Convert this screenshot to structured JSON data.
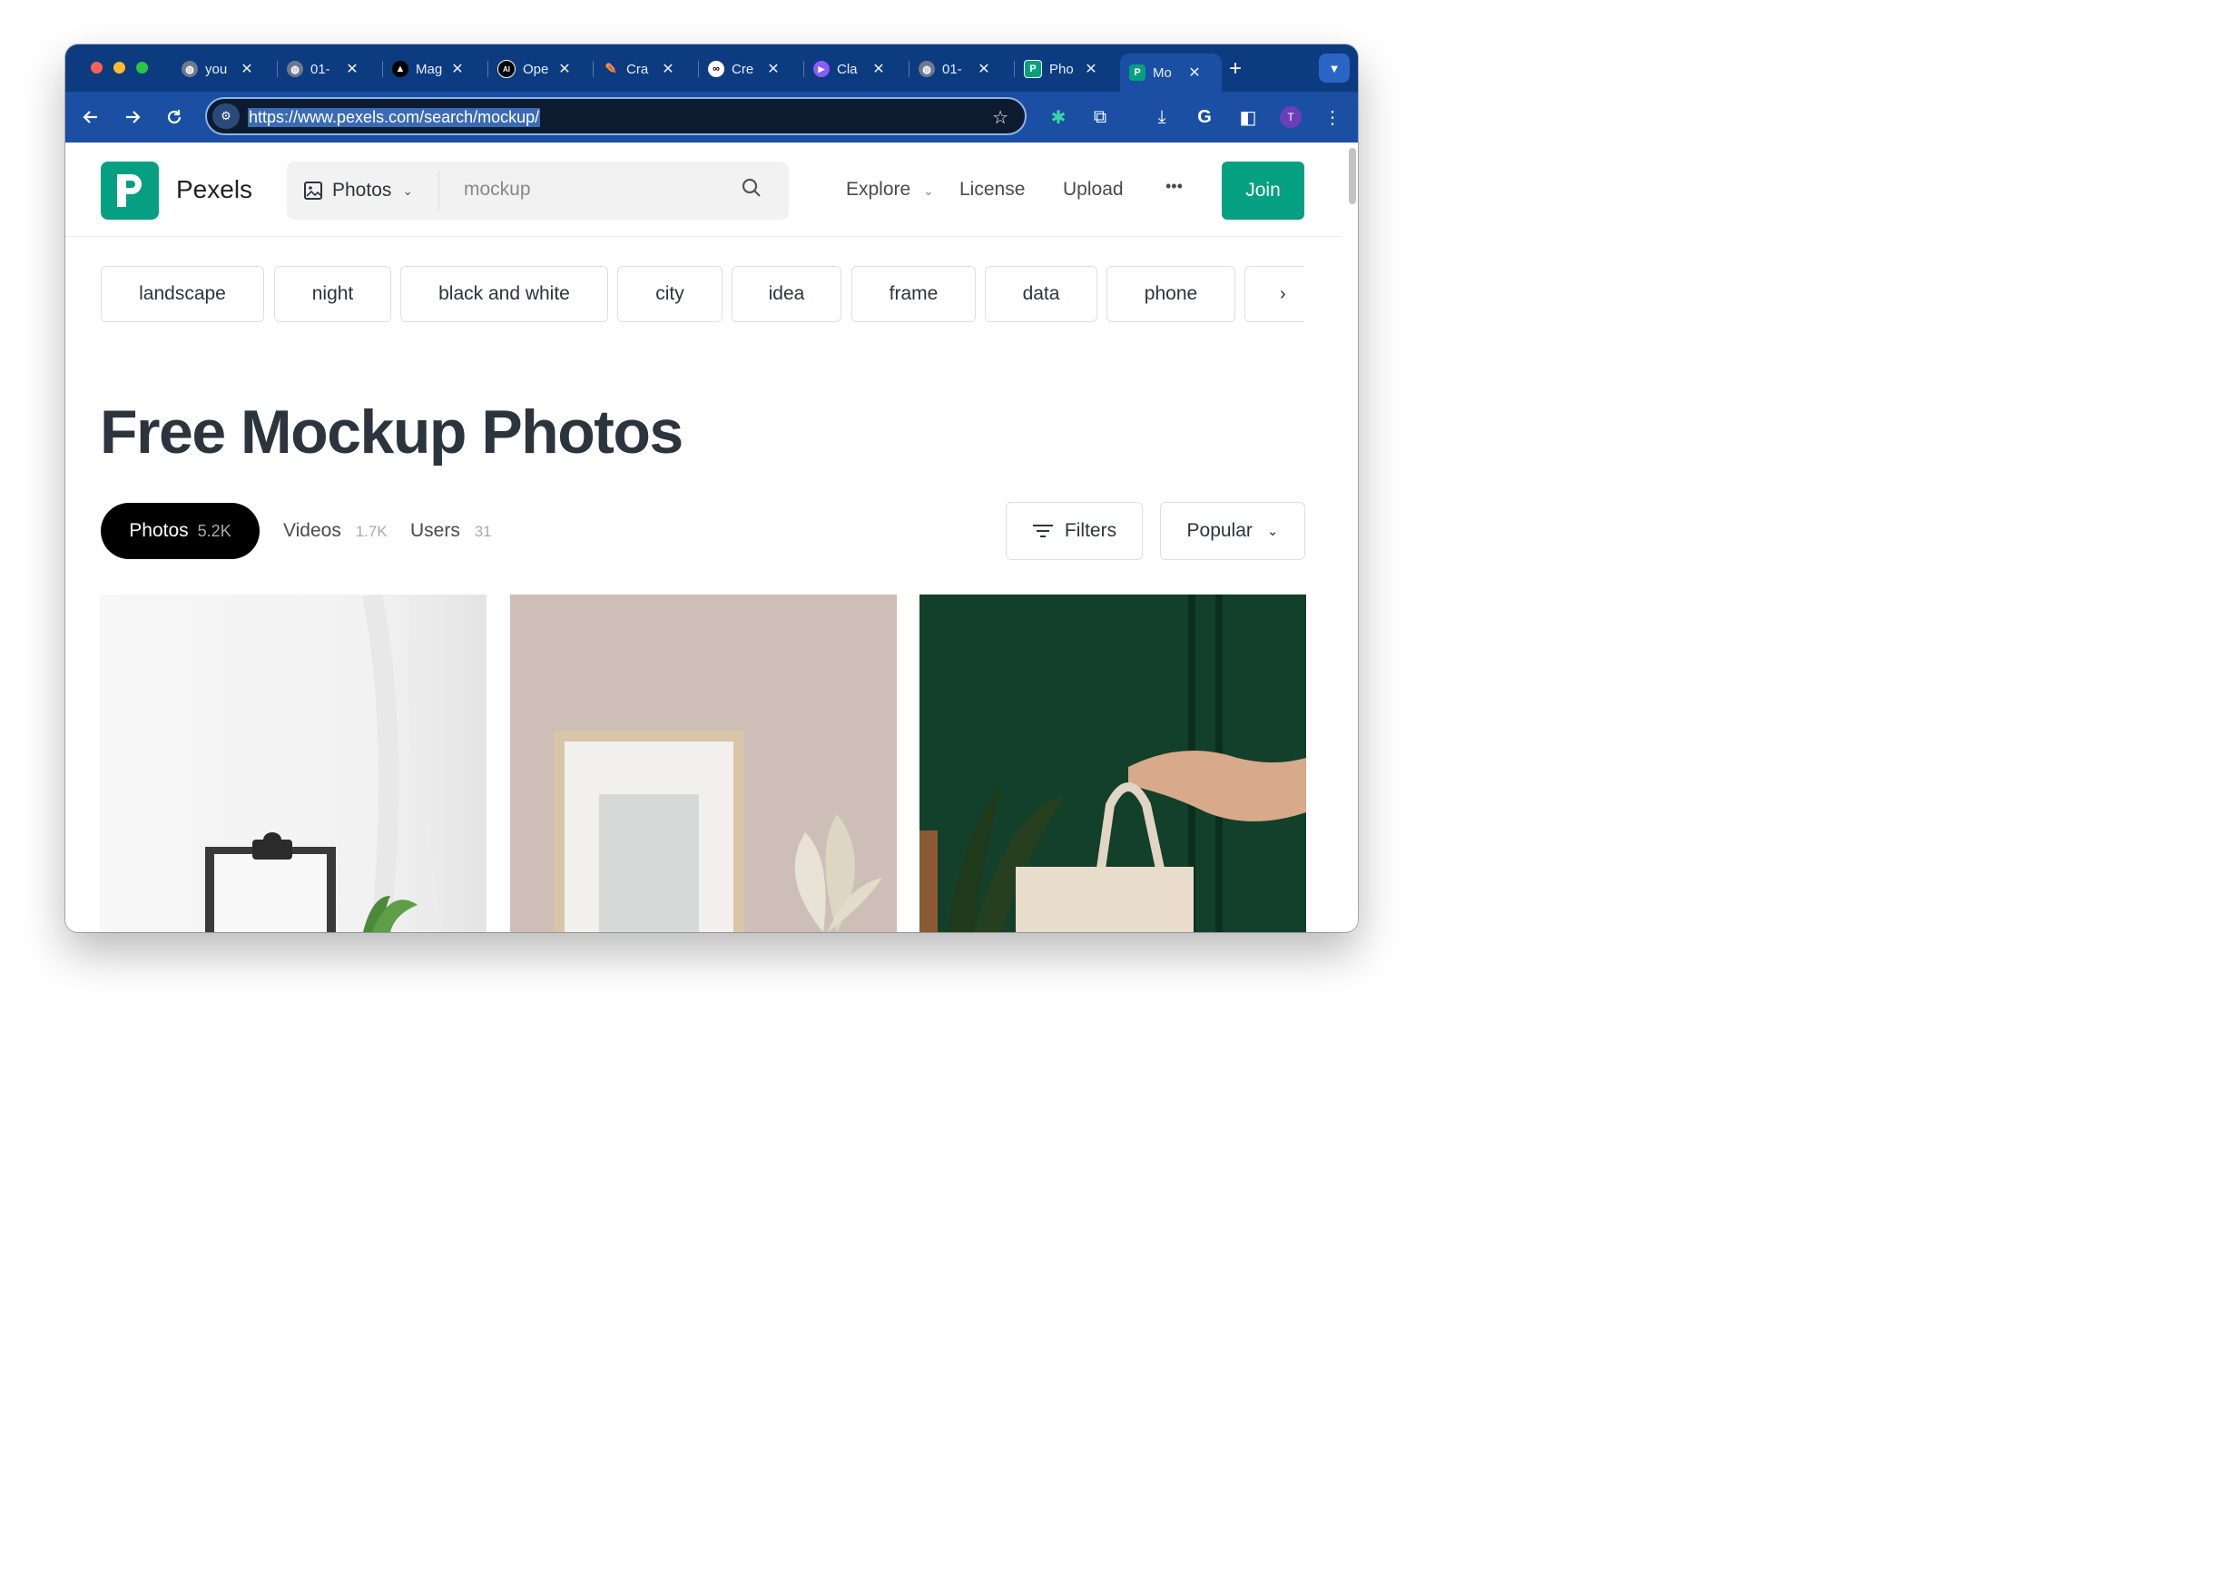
{
  "browser": {
    "tabs": [
      {
        "title": "you",
        "icon": "globe-icon"
      },
      {
        "title": "01-",
        "icon": "globe-icon"
      },
      {
        "title": "Mag",
        "icon": "triangle-logo-icon"
      },
      {
        "title": "Ope",
        "icon": "ai-logo-icon"
      },
      {
        "title": "Cra",
        "icon": "pencil-icon"
      },
      {
        "title": "Cre",
        "icon": "infinity-logo-icon"
      },
      {
        "title": "Cla",
        "icon": "play-logo-icon"
      },
      {
        "title": "01-",
        "icon": "globe-icon"
      },
      {
        "title": "Pho",
        "icon": "pexels-logo-icon"
      },
      {
        "title": "Mo",
        "icon": "pexels-logo-icon",
        "active": true
      }
    ],
    "url": "https://www.pexels.com/search/mockup/",
    "profile_initial": "T"
  },
  "header": {
    "brand": "Pexels",
    "search_type": "Photos",
    "search_placeholder": "mockup",
    "nav": [
      "Explore",
      "License",
      "Upload"
    ],
    "more_label": "•••",
    "join_label": "Join"
  },
  "chips": [
    "landscape",
    "night",
    "black and white",
    "city",
    "idea",
    "frame",
    "data",
    "phone"
  ],
  "page": {
    "title": "Free Mockup Photos",
    "media_tabs": [
      {
        "label": "Photos",
        "count": "5.2K",
        "active": true
      },
      {
        "label": "Videos",
        "count": "1.7K"
      },
      {
        "label": "Users",
        "count": "31"
      }
    ],
    "filters_label": "Filters",
    "sort_label": "Popular"
  },
  "colors": {
    "tab_strip": "#0c3b80",
    "toolbar": "#1a4fa3",
    "brand_green": "#05a081",
    "heading": "#2c343e"
  }
}
